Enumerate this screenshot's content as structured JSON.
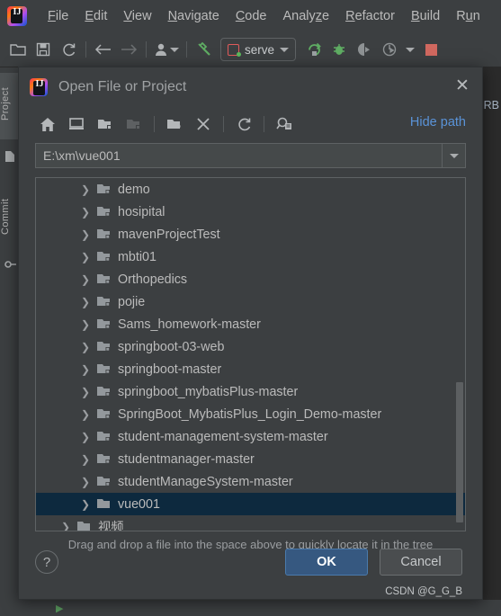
{
  "ide": {
    "logo_letters": "IJ",
    "menus": [
      {
        "label": "File",
        "mnemonic": "F"
      },
      {
        "label": "Edit",
        "mnemonic": "E"
      },
      {
        "label": "View",
        "mnemonic": "V"
      },
      {
        "label": "Navigate",
        "mnemonic": "N"
      },
      {
        "label": "Code",
        "mnemonic": "C"
      },
      {
        "label": "Analyze",
        "mnemonic": "z"
      },
      {
        "label": "Refactor",
        "mnemonic": "R"
      },
      {
        "label": "Build",
        "mnemonic": "B"
      },
      {
        "label": "Run",
        "mnemonic": "u"
      }
    ],
    "toolbar_icons": [
      "open-folder-icon",
      "save-all-icon",
      "sync-refresh-icon",
      "back-arrow-icon",
      "forward-arrow-icon",
      "profile-dropdown-icon",
      "build-hammer-icon"
    ],
    "run_config": {
      "name": "serve",
      "icon": "vue-run-config-icon",
      "dropdown_icon": "chevron-down-icon"
    },
    "run_icons": [
      "run-icon",
      "debug-icon",
      "run-with-coverage-icon",
      "profile-icon",
      "more-dropdown-icon",
      "stop-icon"
    ],
    "left_tabs": [
      {
        "label": "Project",
        "icon": "project-icon",
        "selected": true
      },
      {
        "label": "Commit",
        "icon": "commit-icon",
        "selected": false
      }
    ],
    "right_edge_text": "RB",
    "accent_blue": "#365880",
    "link_blue": "#5a93d8",
    "selection_blue": "#0d293e"
  },
  "dialog": {
    "title": "Open File or Project",
    "close_icon": "close-icon",
    "logo_letters": "IJ",
    "toolbar": [
      {
        "name": "home-icon",
        "disabled": false
      },
      {
        "name": "desktop-icon",
        "disabled": false
      },
      {
        "name": "project-folder-icon",
        "disabled": false
      },
      {
        "name": "module-folder-icon",
        "disabled": true
      },
      {
        "name": "new-folder-icon",
        "disabled": false
      },
      {
        "name": "delete-icon",
        "disabled": false
      },
      {
        "name": "refresh-icon",
        "disabled": false
      },
      {
        "name": "show-hidden-files-icon",
        "disabled": false
      }
    ],
    "hide_path_label": "Hide path",
    "path": {
      "value": "E:\\xm\\vue001",
      "placeholder": "",
      "dropdown_icon": "chevron-down-icon"
    },
    "tree": {
      "items": [
        {
          "label": "demo",
          "indent": 1,
          "selected": false,
          "expandable": true
        },
        {
          "label": "hosipital",
          "indent": 1,
          "selected": false,
          "expandable": true
        },
        {
          "label": "mavenProjectTest",
          "indent": 1,
          "selected": false,
          "expandable": true
        },
        {
          "label": "mbti01",
          "indent": 1,
          "selected": false,
          "expandable": true
        },
        {
          "label": "Orthopedics",
          "indent": 1,
          "selected": false,
          "expandable": true
        },
        {
          "label": "pojie",
          "indent": 1,
          "selected": false,
          "expandable": true
        },
        {
          "label": "Sams_homework-master",
          "indent": 1,
          "selected": false,
          "expandable": true
        },
        {
          "label": "springboot-03-web",
          "indent": 1,
          "selected": false,
          "expandable": true
        },
        {
          "label": "springboot-master",
          "indent": 1,
          "selected": false,
          "expandable": true
        },
        {
          "label": "springboot_mybatisPlus-master",
          "indent": 1,
          "selected": false,
          "expandable": true
        },
        {
          "label": "SpringBoot_MybatisPlus_Login_Demo-master",
          "indent": 1,
          "selected": false,
          "expandable": true
        },
        {
          "label": "student-management-system-master",
          "indent": 1,
          "selected": false,
          "expandable": true
        },
        {
          "label": "studentmanager-master",
          "indent": 1,
          "selected": false,
          "expandable": true
        },
        {
          "label": "studentManageSystem-master",
          "indent": 1,
          "selected": false,
          "expandable": true
        },
        {
          "label": "vue001",
          "indent": 1,
          "selected": true,
          "expandable": true
        },
        {
          "label": "视频",
          "indent": 0,
          "selected": false,
          "expandable": true
        }
      ],
      "scroll_thumb_top_pct": 58,
      "scroll_thumb_height_pct": 40
    },
    "drag_hint": "Drag and drop a file into the space above to quickly locate it in the tree",
    "help_label": "?",
    "ok_label": "OK",
    "cancel_label": "Cancel"
  },
  "watermark": "CSDN @G_G_B"
}
